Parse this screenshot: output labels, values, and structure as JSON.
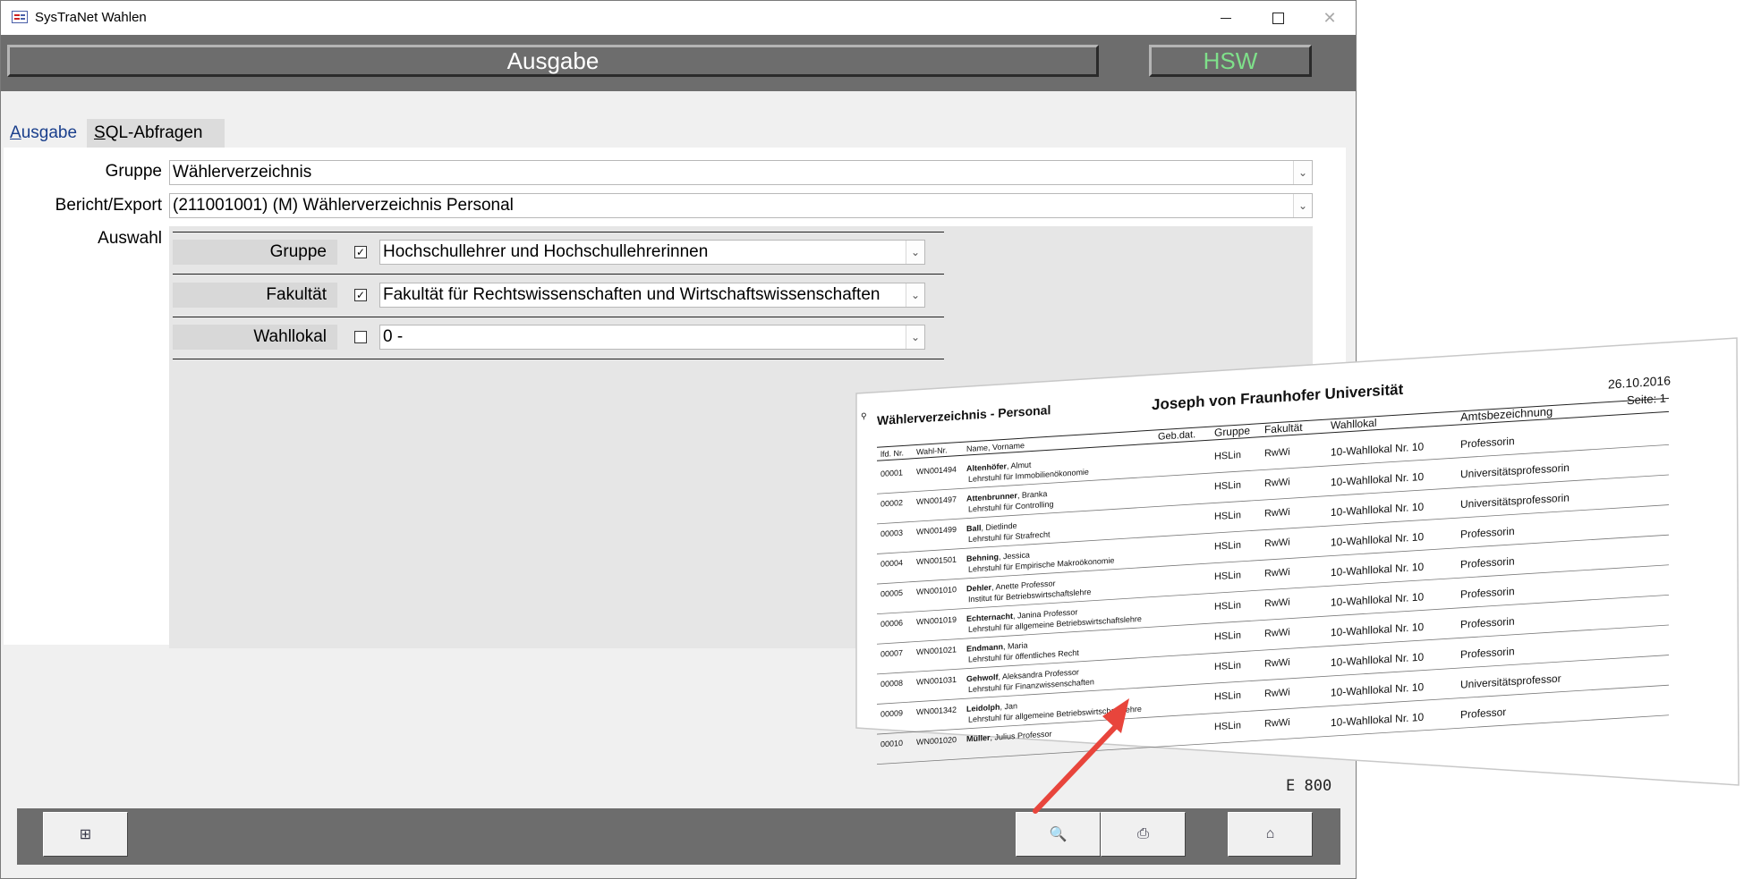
{
  "window": {
    "title": "SysTraNet Wahlen",
    "minimize_glyph": "",
    "maximize_glyph": "",
    "close_glyph": "✕"
  },
  "header": {
    "title": "Ausgabe",
    "hsw_label": "HSW",
    "hsw_color": "#7fe08a"
  },
  "tabs": [
    {
      "label": "Ausgabe",
      "underline": "A",
      "rest": "usgabe",
      "active": true
    },
    {
      "label": "SQL-Abfragen",
      "underline": "S",
      "rest": "QL-Abfragen",
      "active": false
    }
  ],
  "form": {
    "gruppe_label": "Gruppe",
    "gruppe_value": "Wählerverzeichnis",
    "bericht_label": "Bericht/Export",
    "bericht_value": "(211001001)  (M) Wählerverzeichnis Personal",
    "auswahl_label": "Auswahl",
    "rows": [
      {
        "label": "Gruppe",
        "checked": true,
        "check_glyph": "✓",
        "value": "Hochschullehrer und Hochschullehrerinnen"
      },
      {
        "label": "Fakultät",
        "checked": true,
        "check_glyph": "✓",
        "value": "Fakultät für Rechtswissenschaften und Wirtschaftswissenschaften"
      },
      {
        "label": "Wahllokal",
        "checked": false,
        "check_glyph": "",
        "value": "0 -"
      }
    ],
    "dropdown_glyph": "⌄"
  },
  "code_text": "E 800",
  "footer": {
    "buttons": [
      {
        "icon": "sitemap-icon",
        "glyph": "⊞"
      },
      {
        "icon": "print-preview-icon",
        "glyph": "🔍"
      },
      {
        "icon": "printer-icon",
        "glyph": "⎙"
      },
      {
        "icon": "home-icon",
        "glyph": "⌂"
      }
    ]
  },
  "report": {
    "date": "26.10.2016",
    "page": "Seite: 1",
    "title": "Wählerverzeichnis - Personal",
    "university": "Joseph von Fraunhofer Universität",
    "columns": {
      "lfd": "lfd. Nr.",
      "wahl": "Wahl-Nr.",
      "name": "Name, Vorname",
      "geb": "Geb.dat.",
      "gruppe": "Gruppe",
      "fakultaet": "Fakultät",
      "wahllokal": "Wahllokal",
      "amt": "Amtsbezeichnung"
    },
    "rows": [
      {
        "nr": "00001",
        "wahl": "WN001494",
        "name_bold": "Altenhöfer",
        "name_rest": ", Almut",
        "sub": "Lehrstuhl für Immobilienökonomie",
        "gruppe": "HSLin",
        "fak": "RwWi",
        "lokal": "10-Wahllokal Nr. 10",
        "amt": "Professorin"
      },
      {
        "nr": "00002",
        "wahl": "WN001497",
        "name_bold": "Attenbrunner",
        "name_rest": ", Branka",
        "sub": "Lehrstuhl für Controlling",
        "gruppe": "HSLin",
        "fak": "RwWi",
        "lokal": "10-Wahllokal Nr. 10",
        "amt": "Universitätsprofessorin"
      },
      {
        "nr": "00003",
        "wahl": "WN001499",
        "name_bold": "Ball",
        "name_rest": ", Dietlinde",
        "sub": "Lehrstuhl für Strafrecht",
        "gruppe": "HSLin",
        "fak": "RwWi",
        "lokal": "10-Wahllokal Nr. 10",
        "amt": "Universitätsprofessorin"
      },
      {
        "nr": "00004",
        "wahl": "WN001501",
        "name_bold": "Behning",
        "name_rest": ", Jessica",
        "sub": "Lehrstuhl für Empirische Makroökonomie",
        "gruppe": "HSLin",
        "fak": "RwWi",
        "lokal": "10-Wahllokal Nr. 10",
        "amt": "Professorin"
      },
      {
        "nr": "00005",
        "wahl": "WN001010",
        "name_bold": "Dehler",
        "name_rest": ", Anette Professor",
        "sub": "Institut für Betriebswirtschaftslehre",
        "gruppe": "HSLin",
        "fak": "RwWi",
        "lokal": "10-Wahllokal Nr. 10",
        "amt": "Professorin"
      },
      {
        "nr": "00006",
        "wahl": "WN001019",
        "name_bold": "Echternacht",
        "name_rest": ", Janina Professor",
        "sub": "Lehrstuhl für allgemeine Betriebswirtschaftslehre",
        "gruppe": "HSLin",
        "fak": "RwWi",
        "lokal": "10-Wahllokal Nr. 10",
        "amt": "Professorin"
      },
      {
        "nr": "00007",
        "wahl": "WN001021",
        "name_bold": "Endmann",
        "name_rest": ", Maria",
        "sub": "Lehrstuhl für öffentliches Recht",
        "gruppe": "HSLin",
        "fak": "RwWi",
        "lokal": "10-Wahllokal Nr. 10",
        "amt": "Professorin"
      },
      {
        "nr": "00008",
        "wahl": "WN001031",
        "name_bold": "Gehwolf",
        "name_rest": ", Aleksandra Professor",
        "sub": "Lehrstuhl für Finanzwissenschaften",
        "gruppe": "HSLin",
        "fak": "RwWi",
        "lokal": "10-Wahllokal Nr. 10",
        "amt": "Professorin"
      },
      {
        "nr": "00009",
        "wahl": "WN001342",
        "name_bold": "Leidolph",
        "name_rest": ", Jan",
        "sub": "Lehrstuhl für allgemeine Betriebswirtschaftslehre",
        "gruppe": "HSLin",
        "fak": "RwWi",
        "lokal": "10-Wahllokal Nr. 10",
        "amt": "Universitätsprofessor"
      },
      {
        "nr": "00010",
        "wahl": "WN001020",
        "name_bold": "Müller",
        "name_rest": ", Julius Professor",
        "sub": "",
        "gruppe": "HSLin",
        "fak": "RwWi",
        "lokal": "10-Wahllokal Nr. 10",
        "amt": "Professor"
      }
    ],
    "arrow_color": "#e8453c"
  }
}
